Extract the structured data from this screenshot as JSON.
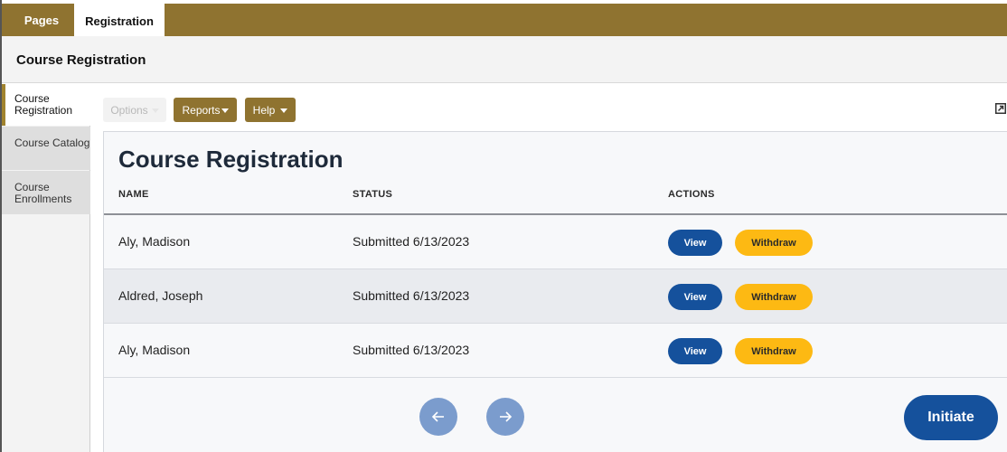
{
  "top_tabs": [
    {
      "label": "Pages"
    },
    {
      "label": "Registration"
    }
  ],
  "page_title": "Course Registration",
  "sidebar": {
    "items": [
      {
        "label": "Course Registration",
        "active": true
      },
      {
        "label": "Course Catalog",
        "active": false
      },
      {
        "label": "Course Enrollments",
        "active": false
      }
    ]
  },
  "toolbar": {
    "options_label": "Options",
    "reports_label": "Reports",
    "help_label": "Help"
  },
  "card": {
    "title": "Course Registration",
    "columns": [
      "NAME",
      "STATUS",
      "ACTIONS"
    ],
    "rows": [
      {
        "name": "Aly, Madison",
        "status": "Submitted 6/13/2023",
        "view_label": "View",
        "withdraw_label": "Withdraw"
      },
      {
        "name": "Aldred, Joseph",
        "status": "Submitted 6/13/2023",
        "view_label": "View",
        "withdraw_label": "Withdraw"
      },
      {
        "name": "Aly, Madison",
        "status": "Submitted 6/13/2023",
        "view_label": "View",
        "withdraw_label": "Withdraw"
      }
    ],
    "initiate_label": "Initiate"
  },
  "icons": {
    "popout": "external-link-icon",
    "prev": "arrow-left-icon",
    "next": "arrow-right-icon"
  },
  "colors": {
    "brand_gold": "#8f7330",
    "primary_blue": "#15519c",
    "withdraw_yellow": "#fdb913",
    "pager_blue": "#7b9ccd"
  }
}
